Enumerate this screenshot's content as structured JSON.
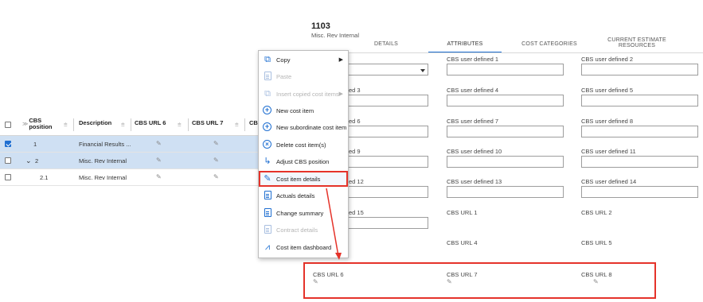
{
  "grid": {
    "headers": {
      "cbs_position": "CBS position",
      "description": "Description",
      "cbs_url6": "CBS URL 6",
      "cbs_url7": "CBS URL 7",
      "cbs_cut": "CBS"
    },
    "rows": [
      {
        "position": "1",
        "description": "Financial Results ...",
        "checked": true,
        "selected": true
      },
      {
        "position": "2",
        "description": "Misc. Rev Internal",
        "checked": false,
        "selected": true
      },
      {
        "position": "2.1",
        "description": "Misc. Rev Internal",
        "checked": false,
        "selected": false
      }
    ]
  },
  "detail": {
    "record_id": "1103",
    "record_name": "Misc. Rev Internal",
    "tabs": [
      "DETAILS",
      "ATTRIBUTES",
      "COST CATEGORIES",
      "CURRENT ESTIMATE RESOURCES"
    ],
    "active_tab": "ATTRIBUTES",
    "fields": {
      "f_d3": "ed 3",
      "f_d6": "ed 6",
      "f_d9": "ed 9",
      "f_d12": "ed 12",
      "f_d15": "ed 15",
      "u1": "CBS user defined 1",
      "u2": "CBS user defined 2",
      "u4": "CBS user defined 4",
      "u5": "CBS user defined 5",
      "u7": "CBS user defined 7",
      "u8": "CBS user defined 8",
      "u10": "CBS user defined 10",
      "u11": "CBS user defined 11",
      "u13": "CBS user defined 13",
      "u14": "CBS user defined 14",
      "url1": "CBS URL 1",
      "url2": "CBS URL 2",
      "url4": "CBS URL 4",
      "url5": "CBS URL 5",
      "url6": "CBS URL 6",
      "url7": "CBS URL 7",
      "url8": "CBS URL 8"
    }
  },
  "menu": {
    "items": [
      {
        "label": "Copy",
        "icon": "copy-icon",
        "disabled": false,
        "submenu": true
      },
      {
        "label": "Paste",
        "icon": "paste-icon",
        "disabled": true,
        "submenu": false
      },
      {
        "label": "Insert copied cost items",
        "icon": "insert-icon",
        "disabled": true,
        "submenu": true
      },
      {
        "label": "New cost item",
        "icon": "add-circle-icon",
        "disabled": false,
        "submenu": false
      },
      {
        "label": "New subordinate cost item",
        "icon": "add-circle-icon",
        "disabled": false,
        "submenu": false
      },
      {
        "label": "Delete cost item(s)",
        "icon": "delete-circle-icon",
        "disabled": false,
        "submenu": false
      },
      {
        "label": "Adjust CBS position",
        "icon": "adjust-arrow-icon",
        "disabled": false,
        "submenu": false
      },
      {
        "label": "Cost item details",
        "icon": "edit-details-icon",
        "disabled": false,
        "submenu": false,
        "highlighted": true
      },
      {
        "label": "Actuals details",
        "icon": "document-icon",
        "disabled": false,
        "submenu": false
      },
      {
        "label": "Change summary",
        "icon": "document-icon",
        "disabled": false,
        "submenu": false
      },
      {
        "label": "Contract details",
        "icon": "document-icon",
        "disabled": true,
        "submenu": false
      },
      {
        "label": "Cost item dashboard",
        "icon": "dashboard-icon",
        "disabled": false,
        "submenu": false
      }
    ]
  },
  "colors": {
    "accent": "#1f6fd1",
    "highlight": "#e5332a",
    "row_selected": "#cfe0f3"
  }
}
